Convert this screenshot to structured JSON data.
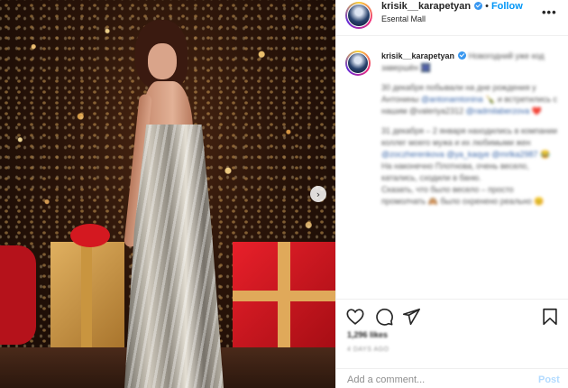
{
  "colors": {
    "accent": "#0095f6",
    "verified": "#3897f0",
    "post_disabled": "#b3dbff",
    "text_primary": "#262626",
    "text_secondary": "#8e8e8e"
  },
  "photo": {
    "carousel_next": "›"
  },
  "header": {
    "username": "krisik__karapetyan",
    "separator": "•",
    "follow_label": "Follow",
    "location": "Esental Mall",
    "more": "•••"
  },
  "caption": {
    "username": "krisik__karapetyan",
    "line1": "Новогодний уже код завершён 🎆",
    "p1_line1": "30 декабря побывали на дне рождения у Антонины",
    "p1_mention1": "@antonamtonina",
    "p1_line2": "🍾 и встретились с нашим @valeriya2312",
    "p1_mention2": "@radmilaberzova",
    "p1_emoji": "❤️",
    "p2_line1": "31 декабря – 2 января находились в компании коллег моего мужа и их любимыми жен",
    "p2_mention1": "@zoczherenkova",
    "p2_mention2": "@ya_kaqye @mrlka2987",
    "p2_emoji": "😂",
    "p2_line2": "На наконечно Плотнова, очень весело, катались, сходили в баню.",
    "p2_line3": "Сказать, что было весело – просто промолчать 🙈 было охренено реально 😊"
  },
  "actions": {
    "like": "like",
    "comment": "comment",
    "share": "share",
    "save": "save"
  },
  "likes_text": "1,296 likes",
  "date_text": "4 DAYS AGO",
  "comment_box": {
    "placeholder": "Add a comment...",
    "post_label": "Post"
  }
}
